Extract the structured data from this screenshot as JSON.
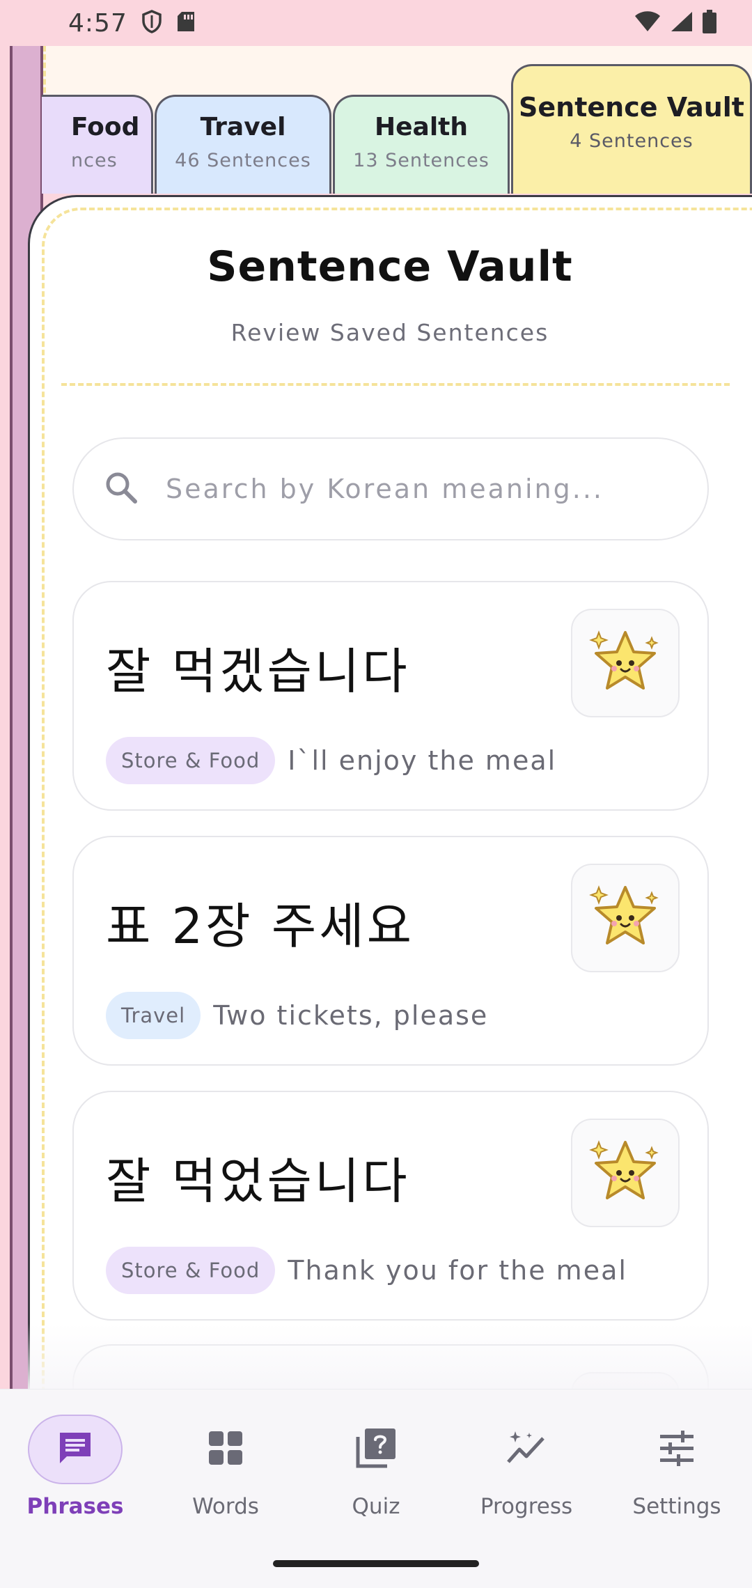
{
  "status_bar": {
    "time": "4:57",
    "left_icons": [
      "shield-icon",
      "sd-card-icon"
    ],
    "right_icons": [
      "wifi-icon",
      "signal-icon",
      "battery-icon"
    ]
  },
  "tabs": [
    {
      "title": "Food",
      "subtitle": "nces",
      "color": "#e8dcfa"
    },
    {
      "title": "Travel",
      "subtitle": "46 Sentences",
      "color": "#d8e8fd"
    },
    {
      "title": "Health",
      "subtitle": "13 Sentences",
      "color": "#d9f4e2"
    },
    {
      "title": "Sentence Vault",
      "subtitle": "4 Sentences",
      "color": "#fbefa8",
      "active": true
    }
  ],
  "header": {
    "title": "Sentence Vault",
    "subtitle": "Review Saved Sentences"
  },
  "search": {
    "placeholder": "Search by Korean meaning...",
    "value": ""
  },
  "sentences": [
    {
      "korean": "잘 먹겠습니다",
      "category": "Store & Food",
      "english": "I`ll enjoy the meal",
      "icon": "star-icon"
    },
    {
      "korean": "표 2장 주세요",
      "category": "Travel",
      "english": "Two tickets, please",
      "icon": "star-icon"
    },
    {
      "korean": "잘 먹었습니다",
      "category": "Store & Food",
      "english": "Thank you for the meal",
      "icon": "star-icon"
    }
  ],
  "bottom_nav": {
    "items": [
      {
        "label": "Phrases",
        "icon": "chat-icon",
        "active": true
      },
      {
        "label": "Words",
        "icon": "grid-icon"
      },
      {
        "label": "Quiz",
        "icon": "quiz-icon"
      },
      {
        "label": "Progress",
        "icon": "sparkle-chart-icon"
      },
      {
        "label": "Settings",
        "icon": "sliders-icon"
      }
    ]
  },
  "colors": {
    "accent": "#7e3fb8",
    "binder_pink": "#fbd6de",
    "vault_yellow": "#fbefa8"
  }
}
